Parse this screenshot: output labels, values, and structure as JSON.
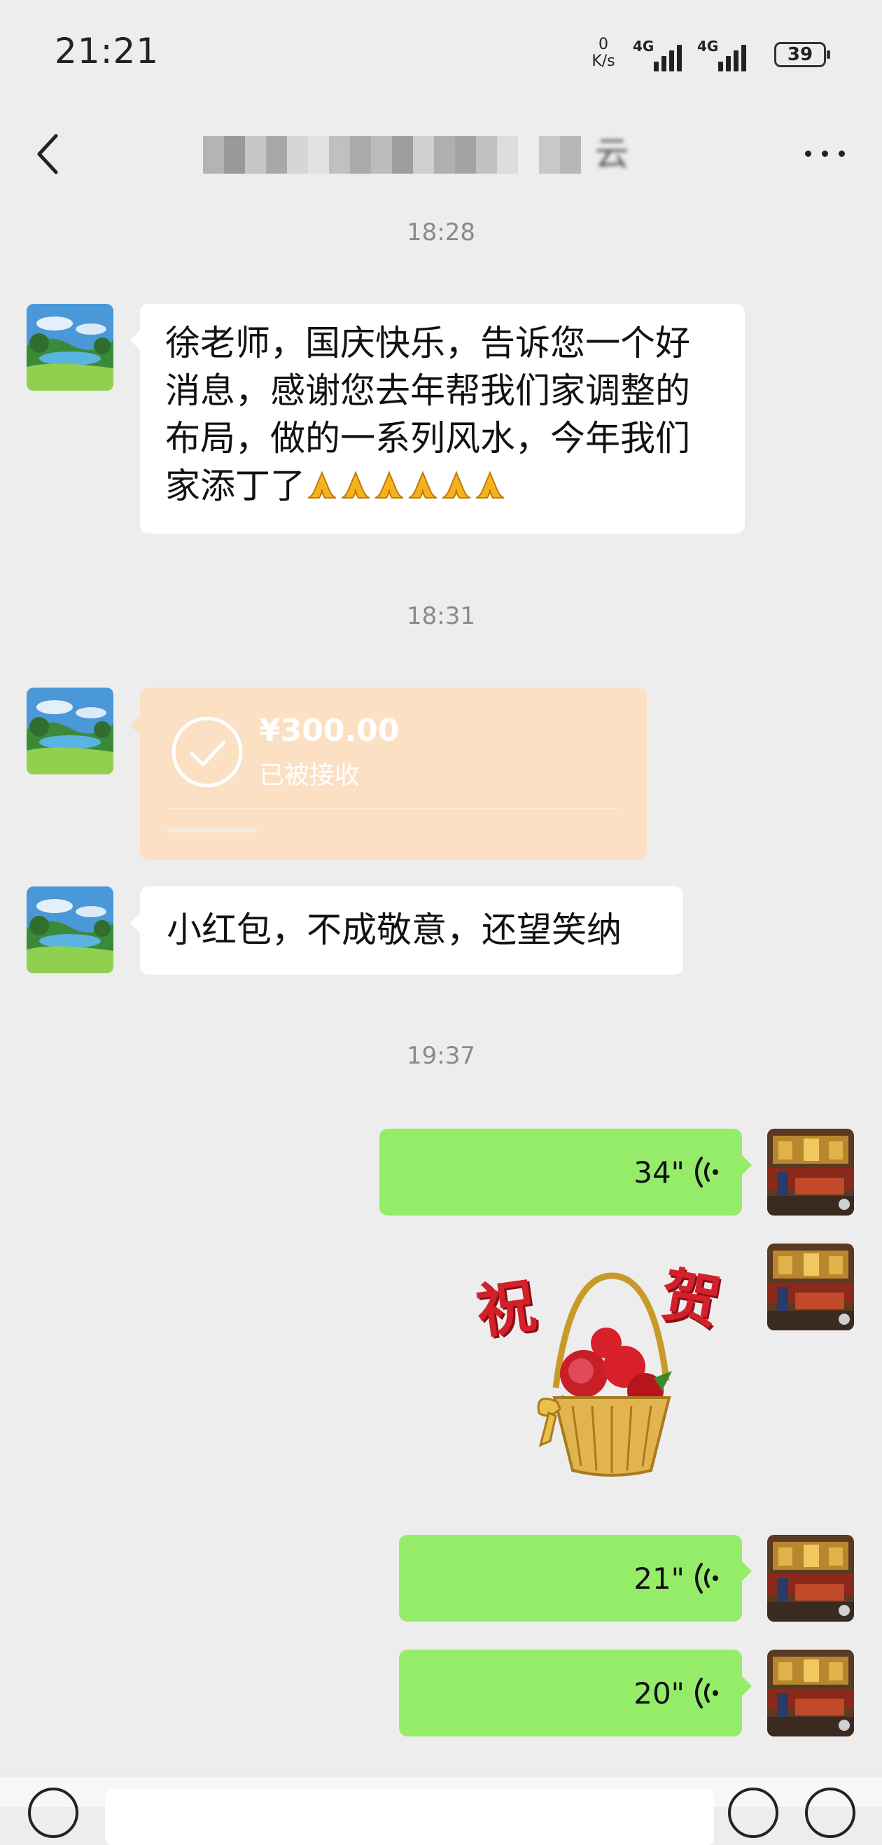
{
  "status_bar": {
    "time": "21:21",
    "net_speed_value": "0",
    "net_speed_unit": "K/s",
    "signal_1": "4G",
    "signal_2": "4G",
    "battery": "39"
  },
  "header": {
    "title_blurred": "■■■■■■■ 云"
  },
  "messages": [
    {
      "type": "time",
      "text": "18:28"
    },
    {
      "type": "text",
      "from": "contact",
      "text": "徐老师，国庆快乐，告诉您一个好消息，感谢您去年帮我们家调整的布局，做的一系列风水，今年我们家添丁了",
      "emoji": "folded-hands",
      "emoji_count": 6
    },
    {
      "type": "time",
      "text": "18:31"
    },
    {
      "type": "transfer",
      "from": "contact",
      "amount": "¥300.00",
      "status": "已被接收"
    },
    {
      "type": "text",
      "from": "contact",
      "text": "小红包，不成敬意，还望笑纳"
    },
    {
      "type": "time",
      "text": "19:37"
    },
    {
      "type": "voice",
      "from": "me",
      "duration": "34\""
    },
    {
      "type": "sticker",
      "from": "me",
      "text": "祝贺"
    },
    {
      "type": "voice",
      "from": "me",
      "duration": "21\""
    },
    {
      "type": "voice",
      "from": "me",
      "duration": "20\""
    }
  ],
  "colors": {
    "background": "#ededed",
    "bubble_in": "#ffffff",
    "bubble_out": "#95ec69",
    "transfer_card": "#fbe0c4",
    "timestamp": "#8a8a8a"
  },
  "icons": [
    "back-icon",
    "more-icon",
    "check-circle-icon",
    "voice-wave-icon",
    "battery-icon",
    "signal-icon"
  ]
}
